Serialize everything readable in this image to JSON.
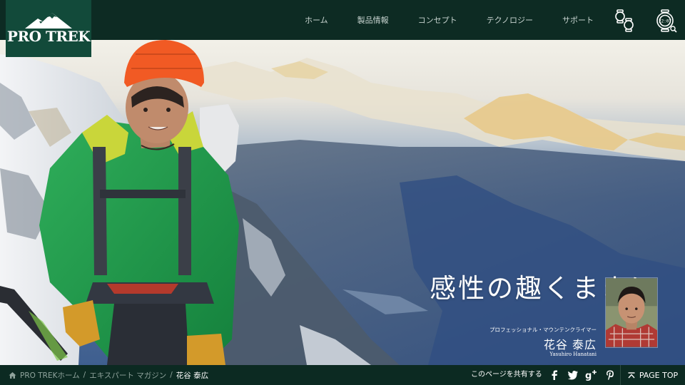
{
  "brand": {
    "logo_text": "PRO TREK",
    "header_bg": "#0d2b23",
    "logo_bg": "#124a3a"
  },
  "nav": {
    "items": [
      {
        "label": "ホーム"
      },
      {
        "label": "製品情報"
      },
      {
        "label": "コンセプト"
      },
      {
        "label": "テクノロジー"
      },
      {
        "label": "サポート"
      }
    ],
    "icons": [
      "watch-compare-icon",
      "watch-search-icon"
    ]
  },
  "hero": {
    "headline": "感性の趣くままに",
    "profile": {
      "role": "プロフェッショナル・マウンテンクライマー",
      "name": "花谷 泰広",
      "roman": "Yasuhiro Hanatani"
    }
  },
  "footer": {
    "breadcrumb": {
      "home": "PRO TREKホーム",
      "separator": "/",
      "section": "エキスパート マガジン",
      "current": "花谷 泰広"
    },
    "share_label": "このページを共有する",
    "social_icons": [
      "facebook-icon",
      "twitter-icon",
      "google-plus-icon",
      "pinterest-icon"
    ],
    "page_top": "PAGE TOP"
  }
}
